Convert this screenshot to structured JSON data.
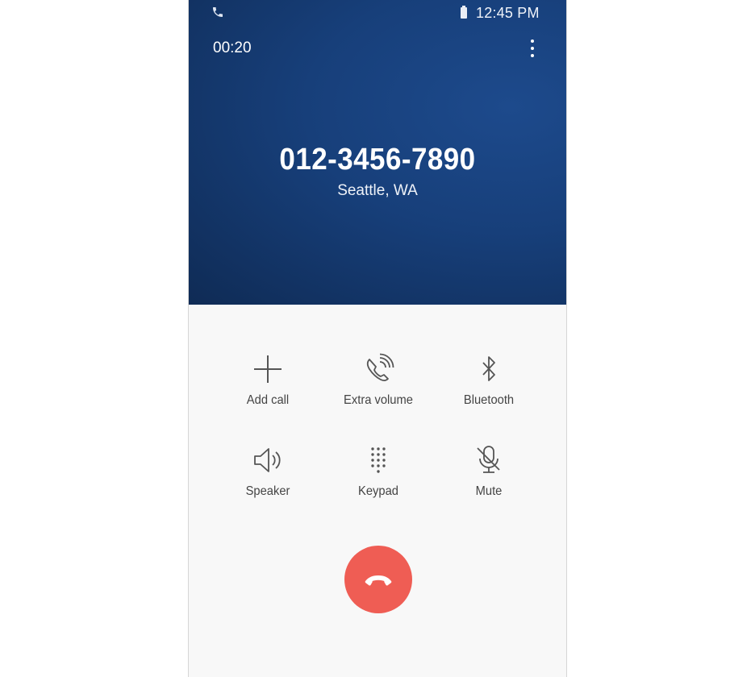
{
  "status_bar": {
    "time": "12:45 PM",
    "icons": [
      "phone-icon",
      "battery-icon"
    ]
  },
  "call": {
    "timer": "00:20",
    "number": "012-3456-7890",
    "location": "Seattle, WA"
  },
  "controls": [
    {
      "label": "Add call",
      "icon": "plus-icon"
    },
    {
      "label": "Extra volume",
      "icon": "phone-volume-icon"
    },
    {
      "label": "Bluetooth",
      "icon": "bluetooth-icon"
    },
    {
      "label": "Speaker",
      "icon": "speaker-icon"
    },
    {
      "label": "Keypad",
      "icon": "keypad-icon"
    },
    {
      "label": "Mute",
      "icon": "mute-mic-icon"
    }
  ],
  "end_call": {
    "icon": "end-call-icon"
  },
  "colors": {
    "header_bg": "#173f7a",
    "end_call": "#ef5d54",
    "control_text": "#444444",
    "control_icon": "#555555"
  }
}
